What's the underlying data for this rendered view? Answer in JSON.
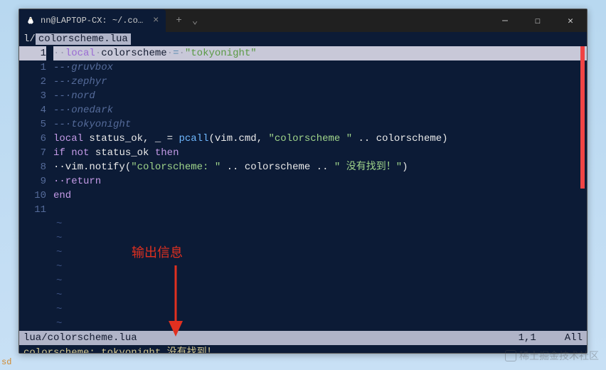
{
  "tab": {
    "title": "nn@LAPTOP-CX: ~/.config/nvim"
  },
  "buffer": {
    "path_prefix": "l/",
    "name": "colorscheme.lua"
  },
  "gutter": {
    "current": "1",
    "rel": [
      "1",
      "2",
      "3",
      "4",
      "5",
      "6",
      "7",
      "8",
      "9",
      "10",
      "11"
    ]
  },
  "code": {
    "l1": {
      "kw": "local",
      "id": "colorscheme",
      "op": "=",
      "str": "\"tokyonight\""
    },
    "l2": "--·gruvbox",
    "l3": "--·zephyr",
    "l4": "--·nord",
    "l5": "--·onedark",
    "l6": "--·tokyonight",
    "l7_kw1": "local",
    "l7_id": "status_ok",
    "l7_p": ", _ = ",
    "l7_fn": "pcall",
    "l7_a": "(vim.cmd, ",
    "l7_s": "\"colorscheme \"",
    "l7_b": " .. colorscheme)",
    "l8_kw1": "if",
    "l8_kw2": "not",
    "l8_id": "status_ok",
    "l8_kw3": "then",
    "l9_a": "··vim.notify(",
    "l9_s1": "\"colorscheme: \"",
    "l9_b": " .. colorscheme .. ",
    "l9_s2": "\" 没有找到！\"",
    "l9_c": ")",
    "l10": "··return",
    "l11": "end"
  },
  "annotation": "输出信息",
  "status": {
    "file": "lua/colorscheme.lua",
    "pos": "1,1",
    "scroll": "All"
  },
  "message": "colorscheme: tokyonight 没有找到！",
  "watermark": "稀土掘金技术社区",
  "corner": "sd"
}
